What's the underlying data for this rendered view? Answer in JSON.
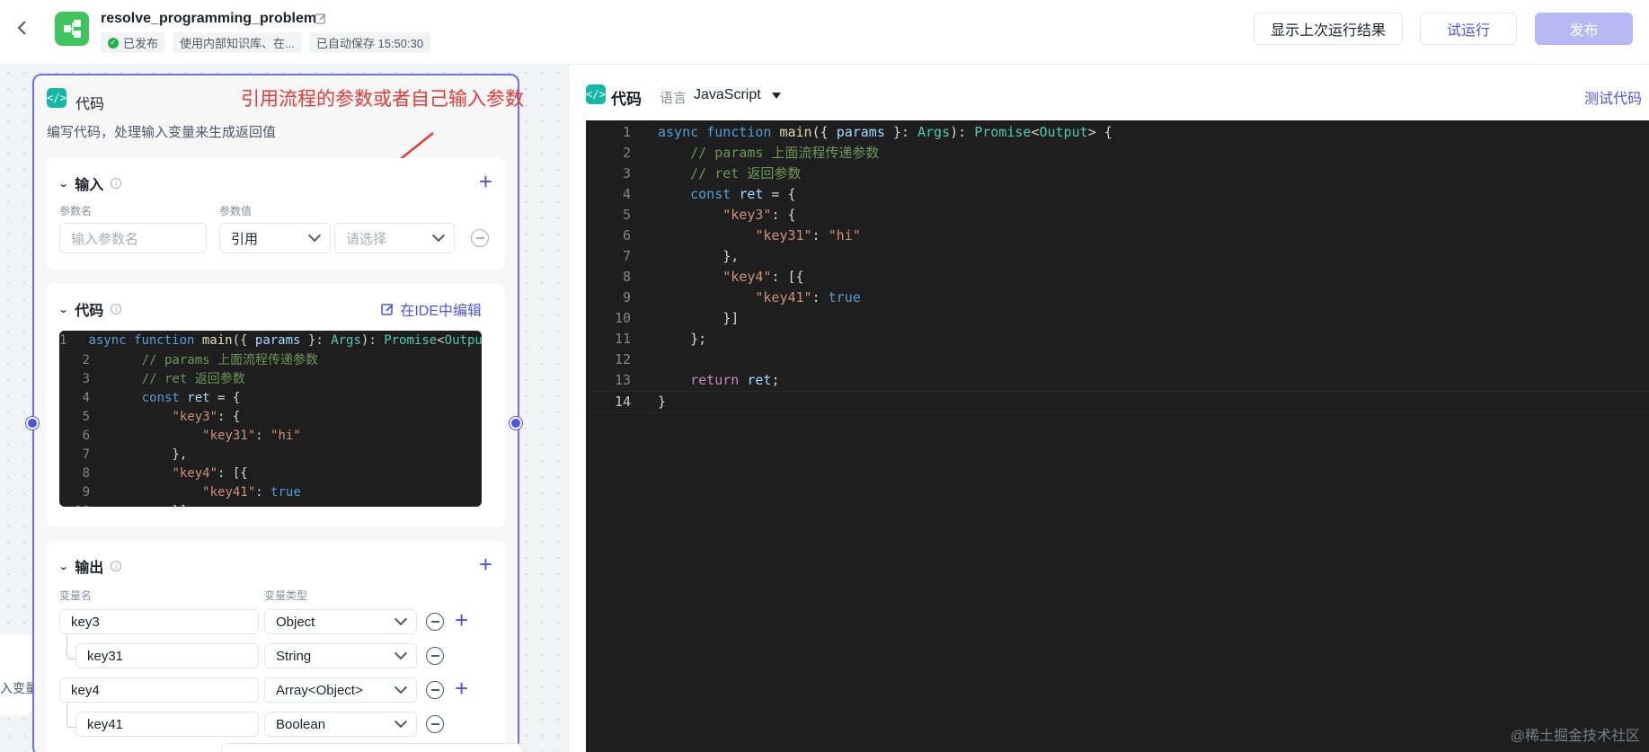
{
  "header": {
    "back_label": "‹",
    "title": "resolve_programming_problem",
    "status_published": "已发布",
    "status_knowledge": "使用内部知识库、在...",
    "status_autosave": "已自动保存 15:50:30",
    "btn_last_result": "显示上次运行结果",
    "btn_trial_run": "试运行",
    "btn_publish": "发布"
  },
  "node": {
    "icon_glyph": "</>",
    "title": "代码",
    "annotation": "引用流程的参数或者自己输入参数",
    "description": "编写代码，处理输入变量来生成返回值",
    "input_section": {
      "title": "输入",
      "col_name": "参数名",
      "col_value": "参数值",
      "name_placeholder": "输入参数名",
      "value_type": "引用",
      "value_placeholder": "请选择"
    },
    "code_section": {
      "title": "代码",
      "ide_link": "在IDE中编辑"
    },
    "output_section": {
      "title": "输出",
      "col_name": "变量名",
      "col_type": "变量类型",
      "rows": [
        {
          "name": "key3",
          "type": "Object"
        },
        {
          "name": "key31",
          "type": "String"
        },
        {
          "name": "key4",
          "type": "Array<Object>"
        },
        {
          "name": "key41",
          "type": "Boolean"
        }
      ]
    },
    "left_card_text": "入变量"
  },
  "code_lines": [
    [
      [
        "k",
        "async "
      ],
      [
        "k",
        "function "
      ],
      [
        "f",
        "main"
      ],
      [
        "p",
        "({ "
      ],
      [
        "v",
        "params"
      ],
      [
        "p",
        " }: "
      ],
      [
        "t",
        "Args"
      ],
      [
        "p",
        "): "
      ],
      [
        "t",
        "Promise"
      ],
      [
        "p",
        "<"
      ],
      [
        "t",
        "Output"
      ],
      [
        "p",
        "> {"
      ]
    ],
    [
      [
        "p",
        "    "
      ],
      [
        "c",
        "// params 上面流程传递参数"
      ]
    ],
    [
      [
        "p",
        "    "
      ],
      [
        "c",
        "// ret 返回参数"
      ]
    ],
    [
      [
        "p",
        "    "
      ],
      [
        "k",
        "const "
      ],
      [
        "v",
        "ret"
      ],
      [
        "p",
        " = {"
      ]
    ],
    [
      [
        "p",
        "        "
      ],
      [
        "s",
        "\"key3\""
      ],
      [
        "p",
        ": {"
      ]
    ],
    [
      [
        "p",
        "            "
      ],
      [
        "s",
        "\"key31\""
      ],
      [
        "p",
        ": "
      ],
      [
        "s",
        "\"hi\""
      ]
    ],
    [
      [
        "p",
        "        },"
      ]
    ],
    [
      [
        "p",
        "        "
      ],
      [
        "s",
        "\"key4\""
      ],
      [
        "p",
        ": [{"
      ]
    ],
    [
      [
        "p",
        "            "
      ],
      [
        "s",
        "\"key41\""
      ],
      [
        "p",
        ": "
      ],
      [
        "k",
        "true"
      ]
    ],
    [
      [
        "p",
        "        }]"
      ]
    ],
    [
      [
        "p",
        "    };"
      ]
    ],
    [
      [
        "p",
        ""
      ]
    ],
    [
      [
        "p",
        "    "
      ],
      [
        "r",
        "return "
      ],
      [
        "v",
        "ret"
      ],
      [
        "p",
        ";"
      ]
    ],
    [
      [
        "p",
        "}"
      ]
    ]
  ],
  "right_panel": {
    "icon_glyph": "</>",
    "title": "代码",
    "lang_label": "语言",
    "lang_value": "JavaScript",
    "test_code": "测试代码",
    "active_line": 14
  },
  "watermark": "@稀土掘金技术社区",
  "colors": {
    "accent": "#4d53e8",
    "publish_disabled": "#b5b9f4",
    "annotation": "#e53935",
    "editor_bg": "#1e1e1e",
    "node_icon": "#14b8a6",
    "app_icon": "#3ec55b"
  },
  "icons": {
    "back": "chevron-left-icon",
    "app": "workflow-icon",
    "edit": "pencil-icon",
    "published": "check-circle-icon",
    "add": "plus-icon",
    "remove": "minus-circle-icon",
    "dropdown": "chevron-down-icon",
    "info": "info-icon",
    "ide": "external-edit-icon"
  }
}
